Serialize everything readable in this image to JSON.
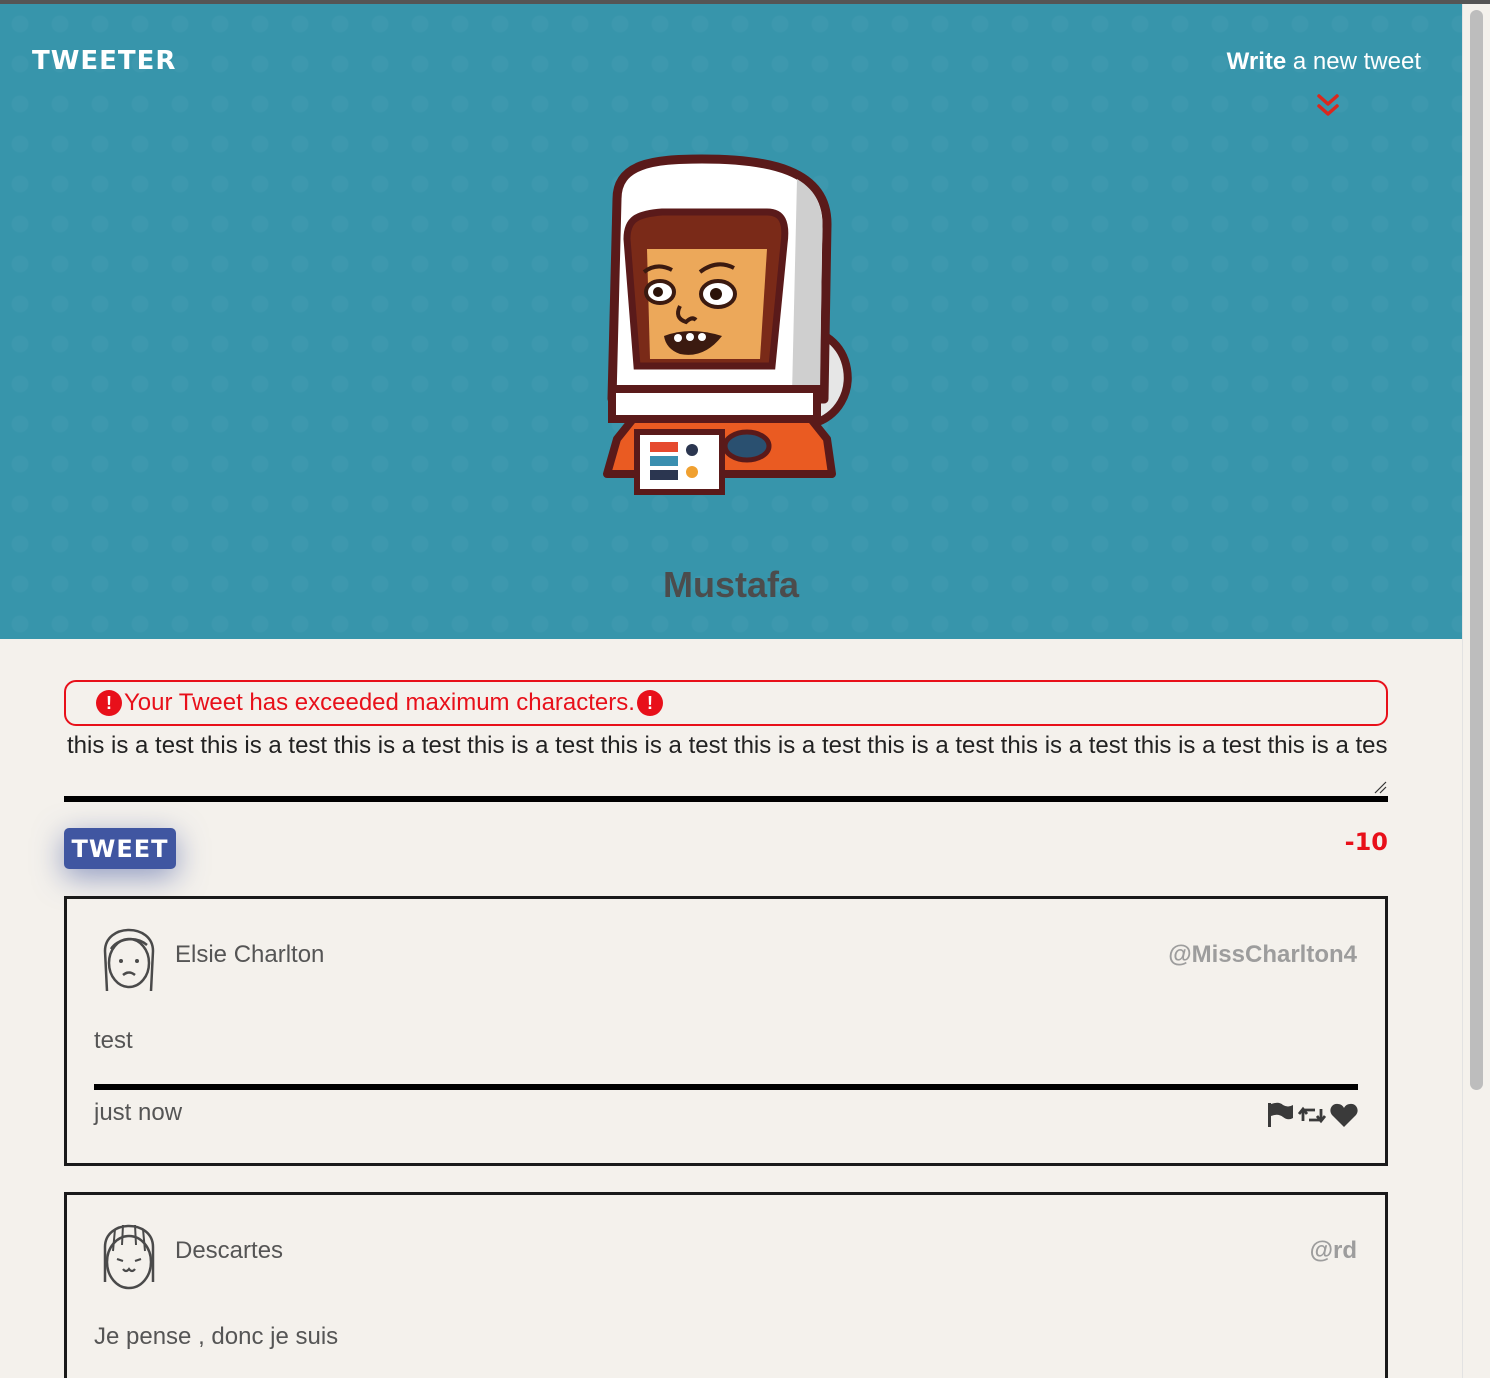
{
  "header": {
    "brand": "TWEETER",
    "compose_bold": "Write",
    "compose_rest": " a new tweet"
  },
  "profile": {
    "name": "Mustafa"
  },
  "composer": {
    "error_message": "Your Tweet has exceeded maximum characters.",
    "error_icon": "!",
    "input_value": "this is a test this is a test this is a test this is a test this is a test this is a test this is a test this is a test this is a test this is a test",
    "submit_label": "TWEET",
    "char_counter": "-10"
  },
  "tweets": [
    {
      "name": "Elsie Charlton",
      "handle": "@MissCharlton4",
      "text": "test",
      "time": "just now"
    },
    {
      "name": "Descartes",
      "handle": "@rd",
      "text": "Je pense , donc je suis"
    }
  ],
  "colors": {
    "hero_bg": "#3795ab",
    "page_bg": "#f4f1ec",
    "error": "#e8101a",
    "button": "#4056a1",
    "handle": "#9d9d9d"
  },
  "icons": [
    "chevron-down-double-icon",
    "error-icon",
    "resize-handle-icon",
    "flag-icon",
    "retweet-icon",
    "heart-icon"
  ]
}
